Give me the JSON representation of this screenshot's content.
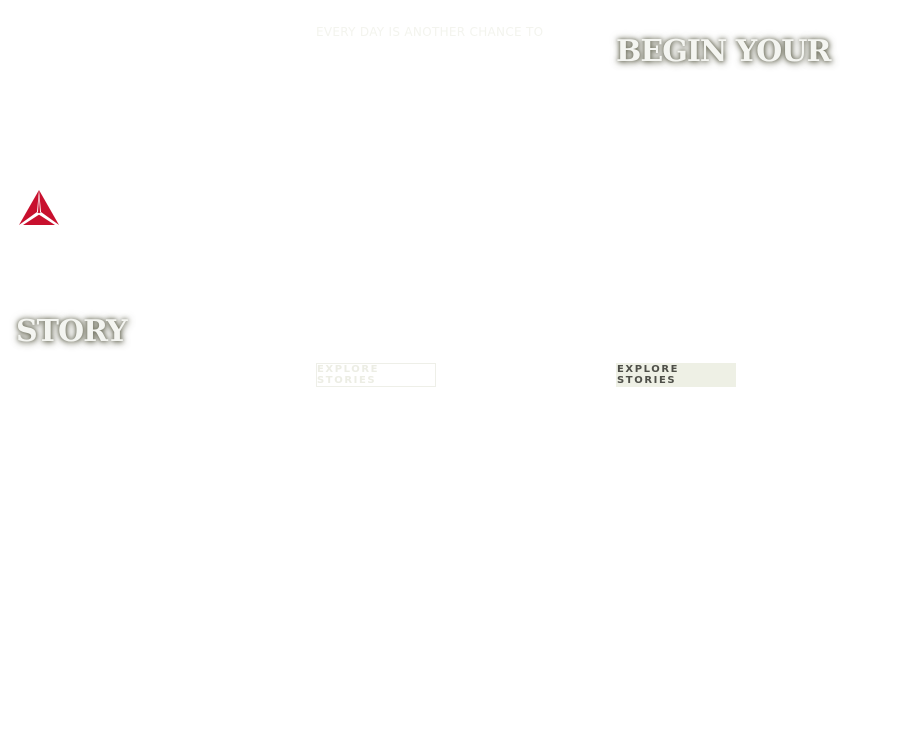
{
  "hero": {
    "tagline": "EVERY DAY IS ANOTHER CHANCE TO",
    "headline_top": "BEGIN YOUR",
    "headline_bottom": "STORY"
  },
  "logo": {
    "icon": "reebok-delta-icon",
    "color": "#c8102e"
  },
  "buttons": {
    "explore_outline_label": "EXPLORE STORIES",
    "explore_filled_label": "EXPLORE STORIES"
  }
}
